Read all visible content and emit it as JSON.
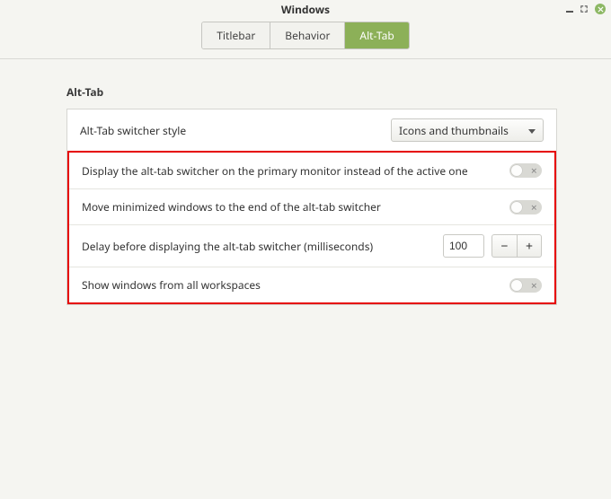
{
  "window": {
    "title": "Windows"
  },
  "tabs": {
    "titlebar": "Titlebar",
    "behavior": "Behavior",
    "alttab": "Alt-Tab",
    "active": "alttab"
  },
  "section": {
    "title": "Alt-Tab"
  },
  "rows": {
    "style": {
      "label": "Alt-Tab switcher style",
      "value": "Icons and thumbnails"
    },
    "primaryMonitor": {
      "label": "Display the alt-tab switcher on the primary monitor instead of the active one",
      "on": false
    },
    "minimizedEnd": {
      "label": "Move minimized windows to the end of the alt-tab switcher",
      "on": false
    },
    "delay": {
      "label": "Delay before displaying the alt-tab switcher (milliseconds)",
      "value": "100"
    },
    "allWorkspaces": {
      "label": "Show windows from all workspaces",
      "on": false
    }
  }
}
